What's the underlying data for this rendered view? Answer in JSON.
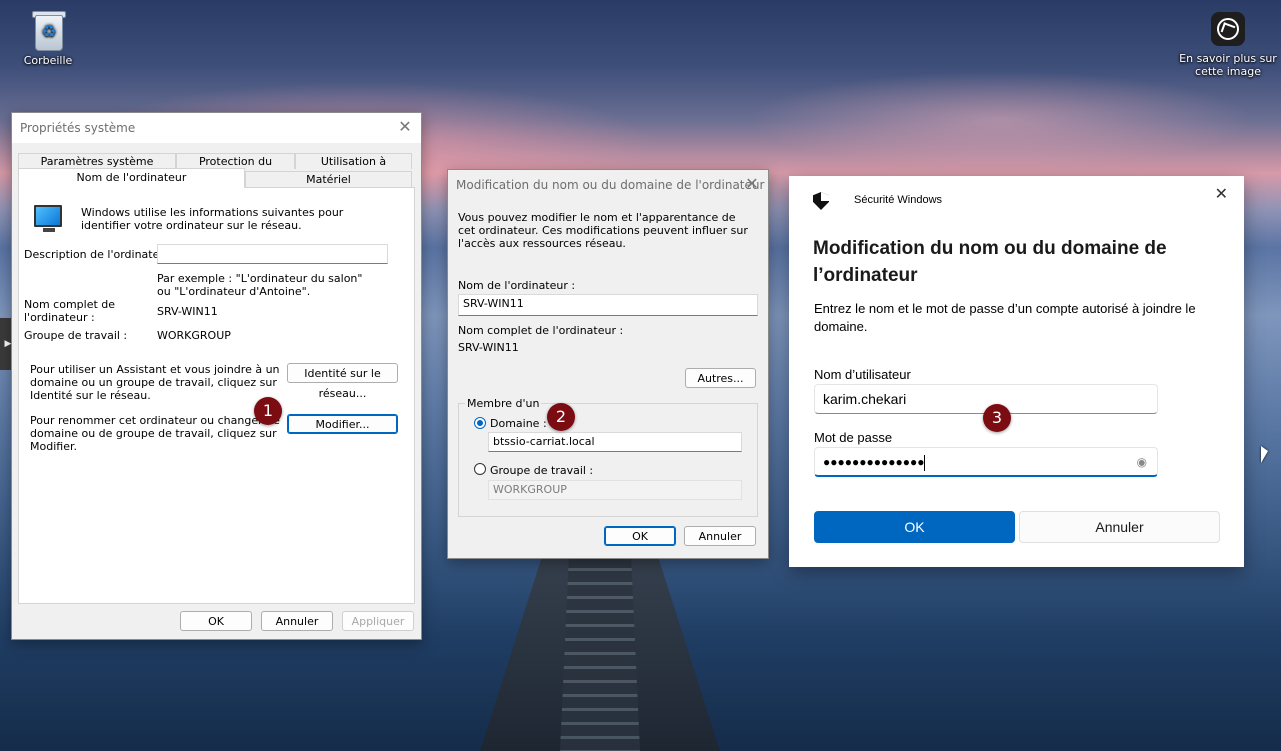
{
  "desktop": {
    "recycle_label": "Corbeille",
    "learn_label": "En savoir plus sur cette image"
  },
  "sysprops": {
    "title": "Propriétés système",
    "tabs_top": [
      "Paramètres système avancés",
      "Protection du système",
      "Utilisation à distance"
    ],
    "tabs_bottom": [
      "Nom de l'ordinateur",
      "Matériel"
    ],
    "intro": "Windows utilise les informations suivantes pour identifier votre ordinateur sur le réseau.",
    "desc_label": "Description de l'ordinateur :",
    "desc_value": "",
    "example": "Par exemple : \"L'ordinateur du salon\" ou \"L'ordinateur d'Antoine\".",
    "fullname_label": "Nom complet de l'ordinateur :",
    "fullname_value": "SRV-WIN11",
    "workgroup_label": "Groupe de travail :",
    "workgroup_value": "WORKGROUP",
    "wizard_text": "Pour utiliser un Assistant et vous joindre à un domaine ou un groupe de travail, cliquez sur Identité sur le réseau.",
    "network_id_button": "Identité sur le réseau...",
    "rename_text": "Pour renommer cet ordinateur ou changer de domaine ou de groupe de travail, cliquez sur Modifier.",
    "modify_button": "Modifier...",
    "ok": "OK",
    "cancel": "Annuler",
    "apply": "Appliquer"
  },
  "rename": {
    "title": "Modification du nom ou du domaine de l'ordinateur",
    "intro": "Vous pouvez modifier le nom et l'apparentance de cet ordinateur. Ces modifications peuvent influer sur l'accès aux ressources réseau.",
    "name_label": "Nom de l'ordinateur :",
    "name_value": "SRV-WIN11",
    "fullname_label": "Nom complet de l'ordinateur :",
    "fullname_value": "SRV-WIN11",
    "more_button": "Autres...",
    "member_legend": "Membre d'un",
    "domain_label": "Domaine :",
    "domain_value": "btssio-carriat.local",
    "workgroup_label": "Groupe de travail :",
    "workgroup_value": "WORKGROUP",
    "ok": "OK",
    "cancel": "Annuler"
  },
  "security": {
    "app_name": "Sécurité Windows",
    "heading": "Modification du nom ou du domaine de l’ordinateur",
    "desc": "Entrez le nom et le mot de passe d’un compte autorisé à joindre le domaine.",
    "user_label": "Nom d’utilisateur",
    "user_value": "karim.chekari",
    "pass_label": "Mot de passe",
    "pass_value": "●●●●●●●●●●●●●●",
    "ok": "OK",
    "cancel": "Annuler"
  },
  "markers": [
    "1",
    "2",
    "3"
  ],
  "colors": {
    "accent": "#0067c0",
    "marker": "#7a0c12"
  }
}
